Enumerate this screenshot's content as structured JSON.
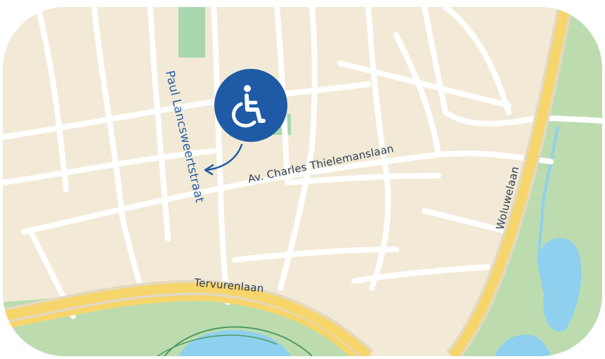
{
  "map": {
    "streets": {
      "av_charles": "Av. Charles Thielemanslaan",
      "tervurenlaan": "Tervurenlaan",
      "woluwelaan": "Woluwelaan"
    },
    "marker": {
      "icon": "wheelchair-accessible-icon",
      "street_label": "Paul Lancsweertstraat",
      "color": "#1e5aa6"
    },
    "colors": {
      "land": "#f2ead6",
      "park": "#b9ddb0",
      "water": "#8fd0ee",
      "major_road": "#f6d56b",
      "minor_road": "#ffffff"
    }
  }
}
